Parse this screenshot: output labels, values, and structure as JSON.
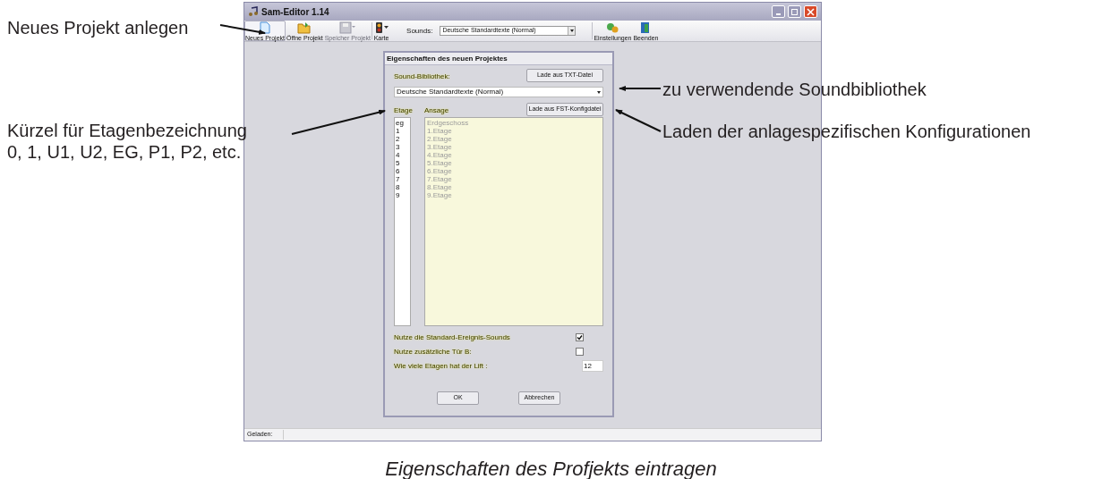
{
  "window": {
    "title": "Sam-Editor 1.14"
  },
  "toolbar": [
    {
      "kind": "new",
      "label": "Neues Projekt",
      "selected": true,
      "disabled": false
    },
    {
      "kind": "open",
      "label": "Öffne Projekt",
      "selected": false,
      "disabled": false
    },
    {
      "kind": "save",
      "label": "Speicher Projekt",
      "selected": false,
      "disabled": true
    },
    {
      "kind": "map",
      "label": "Karte",
      "selected": false,
      "disabled": false
    },
    {
      "kind": "combo",
      "label": "Sounds:",
      "value": "Deutsche Standardtexte (Normal)"
    },
    {
      "kind": "settings",
      "label": "Einstellungen",
      "selected": false,
      "disabled": false
    },
    {
      "kind": "exit",
      "label": "Beenden",
      "selected": false,
      "disabled": false
    }
  ],
  "dialog": {
    "title": "Eigenschaften des neuen Projektes",
    "library_label": "Sound-Bibliothek:",
    "load_txt_button": "Lade aus TXT-Datei",
    "library_value": "Deutsche Standardtexte (Normal)",
    "load_fst_button": "Lade aus FST-Konfigdatei",
    "floor_column": "Etage",
    "announcement_column": "Ansage",
    "floors": [
      "eg",
      "1",
      "2",
      "3",
      "4",
      "5",
      "6",
      "7",
      "8",
      "9"
    ],
    "announcements": [
      "Erdgeschoss",
      "1.Etage",
      "2.Etage",
      "3.Etage",
      "4.Etage",
      "5.Etage",
      "6.Etage",
      "7.Etage",
      "8.Etage",
      "9.Etage"
    ],
    "options": [
      {
        "kind": "checkbox",
        "label": "Nutze die Standard-Ereignis-Sounds",
        "checked": true
      },
      {
        "kind": "checkbox",
        "label": "Nutze zusätzliche Tür B:",
        "checked": false
      },
      {
        "kind": "number",
        "label": "Wie viele Etagen hat der Lift :",
        "value": "12"
      }
    ],
    "buttons": [
      "OK",
      "Abbrechen"
    ]
  },
  "status_bar": {
    "label": "Geladen:"
  },
  "annotations": [
    "Neues Projekt anlegen",
    "zu verwendende Soundbibliothek",
    "Kürzel für Etagenbezeichnung",
    "Laden der anlagespezifischen Konfigurationen",
    "0, 1, U1, U2, EG, P1, P2, etc."
  ],
  "caption": "Eigenschaften des Profjekts eintragen"
}
